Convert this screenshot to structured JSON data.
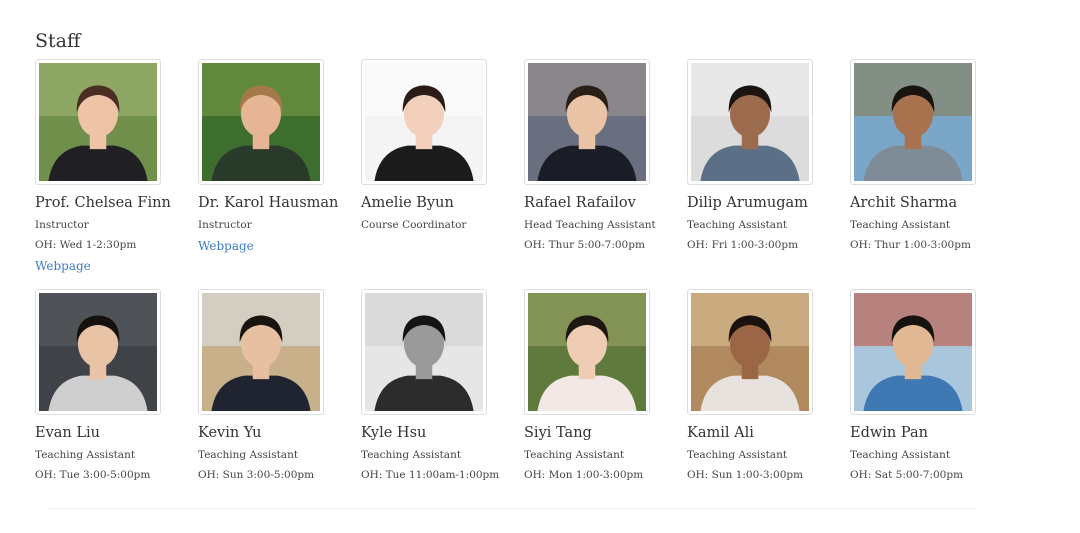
{
  "section_title": "Staff",
  "staff": [
    {
      "name": "Prof. Chelsea Finn",
      "role": "Instructor",
      "oh": "OH: Wed 1-2:30pm",
      "link": "Webpage",
      "colors": {
        "bg": "#6f8f4a",
        "bg2": "#a7b97a",
        "skin": "#efc3a6",
        "hair": "#4a2e22",
        "shirt": "#1f1f24"
      }
    },
    {
      "name": "Dr. Karol Hausman",
      "role": "Instructor",
      "oh": "",
      "link": "Webpage",
      "colors": {
        "bg": "#3e6e2e",
        "bg2": "#7ea04a",
        "skin": "#e5b596",
        "hair": "#a57a4a",
        "shirt": "#2a3a2a"
      }
    },
    {
      "name": "Amelie Byun",
      "role": "Course Coordinator",
      "oh": "",
      "link": "",
      "colors": {
        "bg": "#f4f4f4",
        "bg2": "#ffffff",
        "skin": "#f2d0bb",
        "hair": "#2b1c18",
        "shirt": "#1b1b1b"
      }
    },
    {
      "name": "Rafael Rafailov",
      "role": "Head Teaching Assistant",
      "oh": "OH: Thur 5:00-7:00pm",
      "link": "",
      "colors": {
        "bg": "#6a6f80",
        "bg2": "#a49a96",
        "skin": "#eac3a7",
        "hair": "#2b2018",
        "shirt": "#1b1d26"
      }
    },
    {
      "name": "Dilip Arumugam",
      "role": "Teaching Assistant",
      "oh": "OH: Fri 1:00-3:00pm",
      "link": "",
      "colors": {
        "bg": "#dcdcdc",
        "bg2": "#f2f2f2",
        "skin": "#9c6a4c",
        "hair": "#1c1410",
        "shirt": "#5b6f86"
      }
    },
    {
      "name": "Archit Sharma",
      "role": "Teaching Assistant",
      "oh": "OH: Thur 1:00-3:00pm",
      "link": "",
      "colors": {
        "bg": "#7aa6c8",
        "bg2": "#8a7a4e",
        "skin": "#a8724e",
        "hair": "#1a1410",
        "shirt": "#7f8b96"
      }
    },
    {
      "name": "Evan Liu",
      "role": "Teaching Assistant",
      "oh": "OH: Tue 3:00-5:00pm",
      "link": "",
      "colors": {
        "bg": "#3f4246",
        "bg2": "#5c6066",
        "skin": "#e9c3a6",
        "hair": "#14110f",
        "shirt": "#cfcfcf"
      }
    },
    {
      "name": "Kevin Yu",
      "role": "Teaching Assistant",
      "oh": "OH: Sun 3:00-5:00pm",
      "link": "",
      "colors": {
        "bg": "#c8b08a",
        "bg2": "#dfe6ee",
        "skin": "#e6c0a0",
        "hair": "#1a1410",
        "shirt": "#1f2430"
      }
    },
    {
      "name": "Kyle Hsu",
      "role": "Teaching Assistant",
      "oh": "OH: Tue 11:00am-1:00pm",
      "link": "",
      "colors": {
        "bg": "#e6e6e6",
        "bg2": "#cfcfcf",
        "skin": "#9a9a9a",
        "hair": "#141414",
        "shirt": "#2c2c2c"
      }
    },
    {
      "name": "Siyi Tang",
      "role": "Teaching Assistant",
      "oh": "OH: Mon 1:00-3:00pm",
      "link": "",
      "colors": {
        "bg": "#5f7a3c",
        "bg2": "#a0a86a",
        "skin": "#efccb4",
        "hair": "#1e1612",
        "shirt": "#f2e8e6"
      }
    },
    {
      "name": "Kamil Ali",
      "role": "Teaching Assistant",
      "oh": "OH: Sun 1:00-3:00pm",
      "link": "",
      "colors": {
        "bg": "#b08a5e",
        "bg2": "#e0c79c",
        "skin": "#9a6646",
        "hair": "#1a120e",
        "shirt": "#e7e2de"
      }
    },
    {
      "name": "Edwin Pan",
      "role": "Teaching Assistant",
      "oh": "OH: Sat 5:00-7:00pm",
      "link": "",
      "colors": {
        "bg": "#a9c6dc",
        "bg2": "#c24a32",
        "skin": "#e2b894",
        "hair": "#16120e",
        "shirt": "#3f79b4"
      }
    }
  ]
}
